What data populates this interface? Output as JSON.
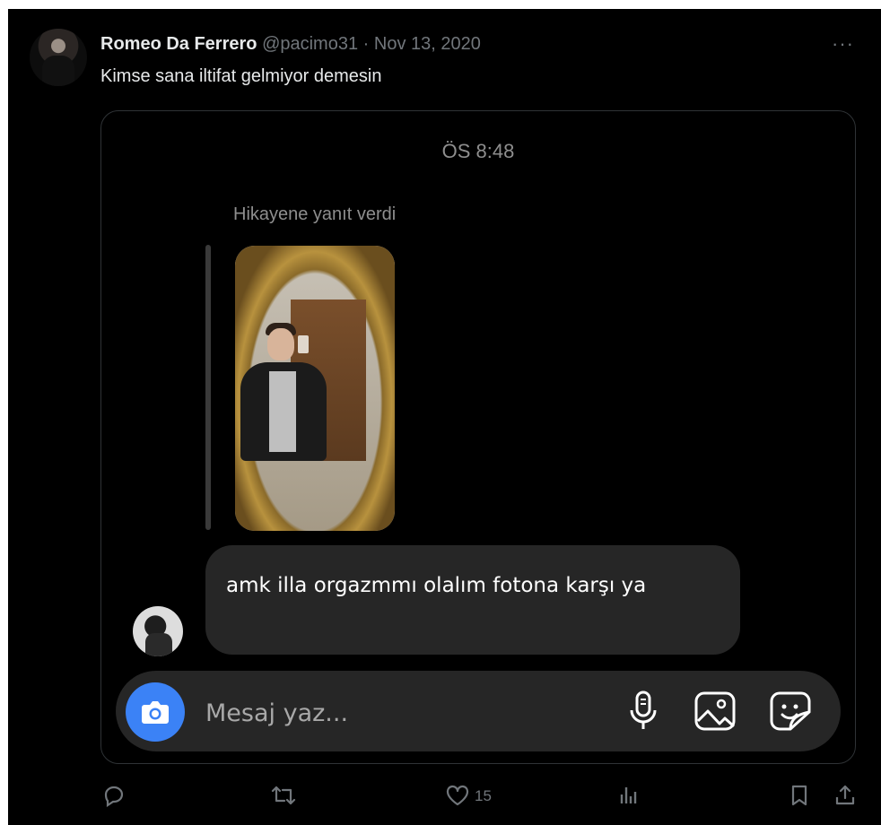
{
  "tweet": {
    "author_name": "Romeo Da Ferrero",
    "author_handle": "@pacimo31",
    "separator": "·",
    "date": "Nov 13, 2020",
    "text": "Kimse sana iltifat gelmiyor demesin",
    "more_icon": "ellipsis-icon"
  },
  "screenshot": {
    "time": "ÖS 8:48",
    "story_caption": "Hikayene yanıt verdi",
    "message_text": "amk illa orgazmmı olalım fotona karşı ya",
    "composer_placeholder": "Mesaj yaz...",
    "composer_icons": [
      "camera-icon",
      "microphone-icon",
      "gallery-icon",
      "sticker-icon"
    ],
    "accent_color": "#3b82f6"
  },
  "actions": {
    "reply_icon": "reply-icon",
    "retweet_icon": "retweet-icon",
    "like_icon": "heart-icon",
    "like_count": "15",
    "views_icon": "views-icon",
    "bookmark_icon": "bookmark-icon",
    "share_icon": "share-icon"
  }
}
